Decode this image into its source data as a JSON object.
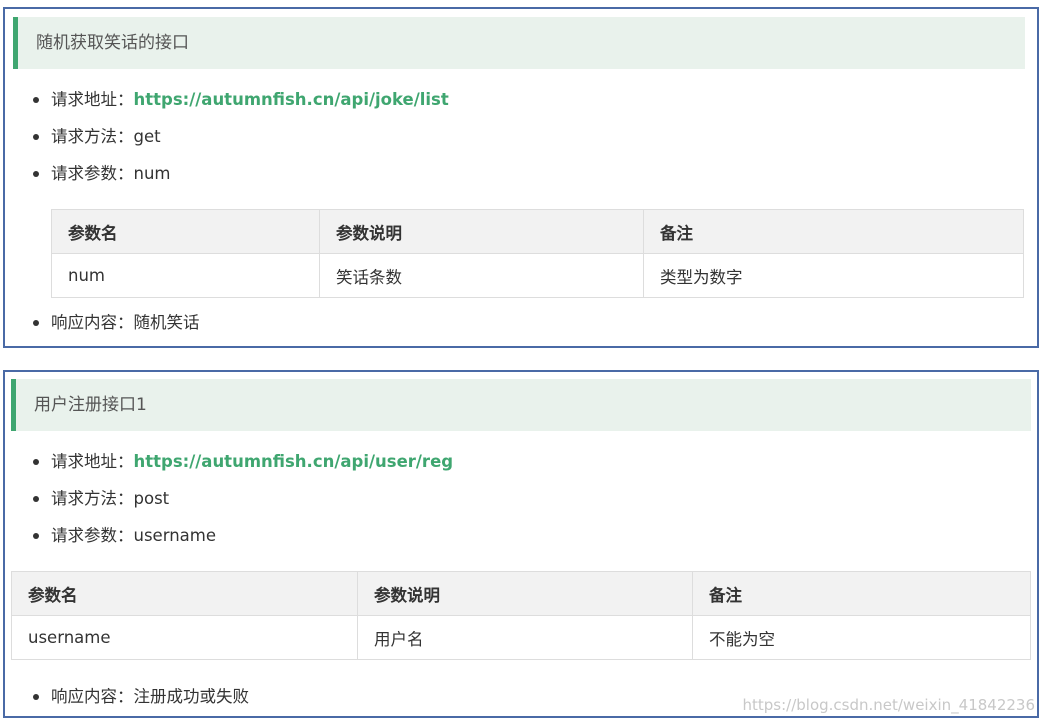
{
  "panel1": {
    "heading": "随机获取笑话的接口",
    "request_url_label": "请求地址：",
    "request_url": "https://autumnfish.cn/api/joke/list",
    "request_method_label": "请求方法：",
    "request_method": "get",
    "request_params_label": "请求参数：",
    "request_params": "num",
    "table": {
      "headers": [
        "参数名",
        "参数说明",
        "备注"
      ],
      "rows": [
        [
          "num",
          "笑话条数",
          "类型为数字"
        ]
      ]
    },
    "response_label": "响应内容：",
    "response": "随机笑话"
  },
  "panel2": {
    "heading": "用户注册接口1",
    "request_url_label": "请求地址：",
    "request_url": "https://autumnfish.cn/api/user/reg",
    "request_method_label": "请求方法：",
    "request_method": "post",
    "request_params_label": "请求参数：",
    "request_params": "username",
    "table": {
      "headers": [
        "参数名",
        "参数说明",
        "备注"
      ],
      "rows": [
        [
          "username",
          "用户名",
          "不能为空"
        ]
      ]
    },
    "response_label": "响应内容：",
    "response": "注册成功或失败"
  },
  "watermark": "https://blog.csdn.net/weixin_41842236",
  "colors": {
    "accent_green": "#3fa670",
    "heading_bg": "#e9f2ec",
    "panel_border": "#4a6aa6",
    "table_header_bg": "#f2f2f2"
  }
}
